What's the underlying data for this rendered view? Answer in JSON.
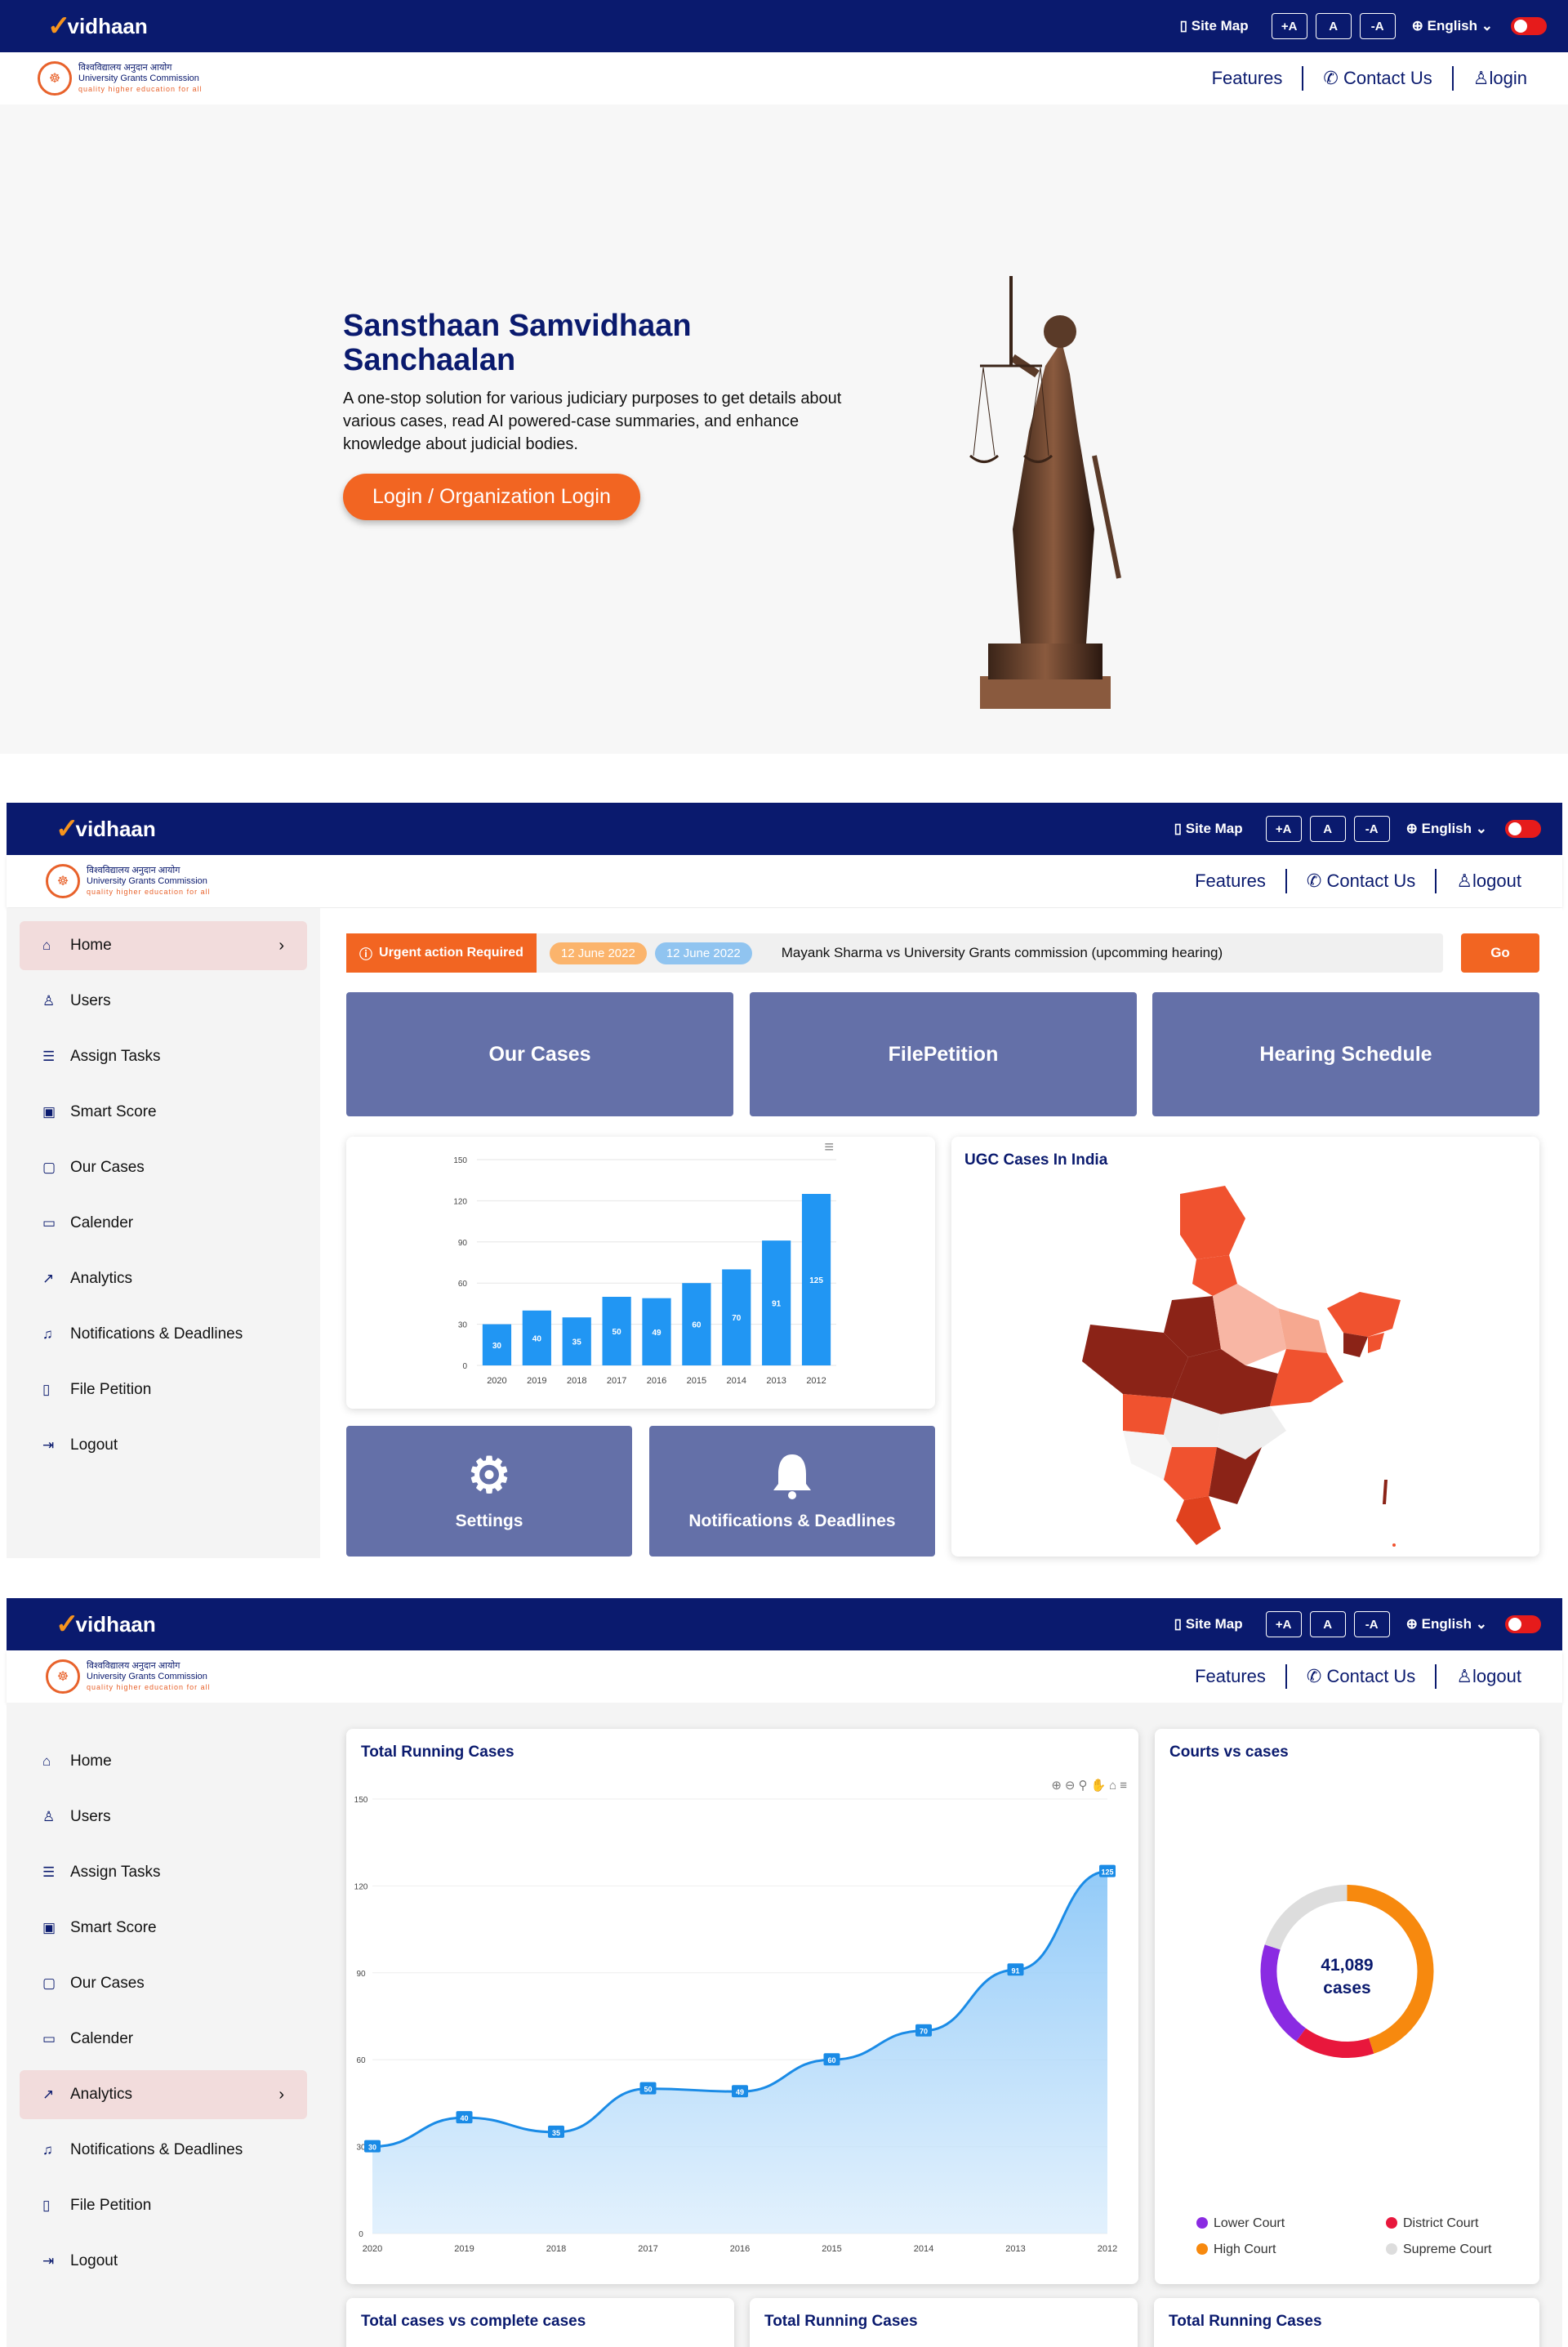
{
  "brand": {
    "logo": "vidhaan",
    "ugc_hindi": "विश्वविद्यालय अनुदान आयोग",
    "ugc_name": "University Grants Commission",
    "ugc_tagline": "quality higher education for all"
  },
  "topbar": {
    "site_map": "Site Map",
    "font_plus": "+A",
    "font_normal": "A",
    "font_minus": "-A",
    "language": "English"
  },
  "nav": {
    "features": "Features",
    "contact": "Contact Us",
    "login": "login",
    "logout": "logout"
  },
  "hero": {
    "title": "Sansthaan Samvidhaan Sanchaalan",
    "description": "A one-stop solution for various judiciary purposes to get details about various cases, read AI powered-case summaries, and enhance knowledge about judicial bodies.",
    "button": "Login / Organization Login"
  },
  "sidebar": {
    "items": [
      {
        "label": "Home",
        "icon": "home-icon"
      },
      {
        "label": "Users",
        "icon": "user-icon"
      },
      {
        "label": "Assign Tasks",
        "icon": "tasks-icon"
      },
      {
        "label": "Smart Score",
        "icon": "score-icon"
      },
      {
        "label": "Our Cases",
        "icon": "clipboard-icon"
      },
      {
        "label": "Calender",
        "icon": "calendar-icon"
      },
      {
        "label": "Analytics",
        "icon": "analytics-icon"
      },
      {
        "label": "Notifications & Deadlines",
        "icon": "bell-icon"
      },
      {
        "label": "File Petition",
        "icon": "file-icon"
      },
      {
        "label": "Logout",
        "icon": "logout-icon"
      }
    ]
  },
  "alert": {
    "label": "Urgent action Required",
    "date1": "12 June 2022",
    "date2": "12 June 2022",
    "message": "Mayank Sharma vs University Grants commission (upcomming hearing)",
    "go": "Go"
  },
  "tiles": {
    "cases": "Our Cases",
    "petition": "FilePetition",
    "hearing": "Hearing Schedule",
    "settings": "Settings",
    "notifications": "Notifications & Deadlines"
  },
  "map": {
    "title": "UGC Cases In India"
  },
  "analytics": {
    "running_title": "Total Running Cases",
    "courts_title": "Courts vs cases",
    "donut_value": "41,089",
    "donut_unit": "cases",
    "bottom1": "Total cases vs complete cases",
    "bottom2": "Total Running Cases",
    "bottom3": "Total Running Cases"
  },
  "colors": {
    "navy": "#0a1a6e",
    "accent": "#f26522",
    "tile": "#6470a8",
    "bar": "#2196f3"
  },
  "chart_data": [
    {
      "type": "bar",
      "categories": [
        "2020",
        "2019",
        "2018",
        "2017",
        "2016",
        "2015",
        "2014",
        "2013",
        "2012"
      ],
      "values": [
        30,
        40,
        35,
        50,
        49,
        60,
        70,
        91,
        125
      ],
      "ylim": [
        0,
        150
      ],
      "yticks": [
        0,
        30,
        60,
        90,
        120,
        150
      ]
    },
    {
      "type": "area",
      "title": "Total Running Cases",
      "categories": [
        "2020",
        "2019",
        "2018",
        "2017",
        "2016",
        "2015",
        "2014",
        "2013",
        "2012"
      ],
      "values": [
        30,
        40,
        35,
        50,
        49,
        60,
        70,
        91,
        125
      ],
      "ylim": [
        0,
        150
      ],
      "yticks": [
        0,
        30,
        60,
        90,
        120,
        150
      ]
    },
    {
      "type": "pie",
      "title": "Courts vs cases",
      "total": "41,089",
      "series": [
        {
          "name": "Lower Court",
          "color": "#8a2be2",
          "value": 20
        },
        {
          "name": "District Court",
          "color": "#e8173c",
          "value": 15
        },
        {
          "name": "High Court",
          "color": "#f7890e",
          "value": 45
        },
        {
          "name": "Supreme Court",
          "color": "#dddddd",
          "value": 20
        }
      ]
    }
  ]
}
